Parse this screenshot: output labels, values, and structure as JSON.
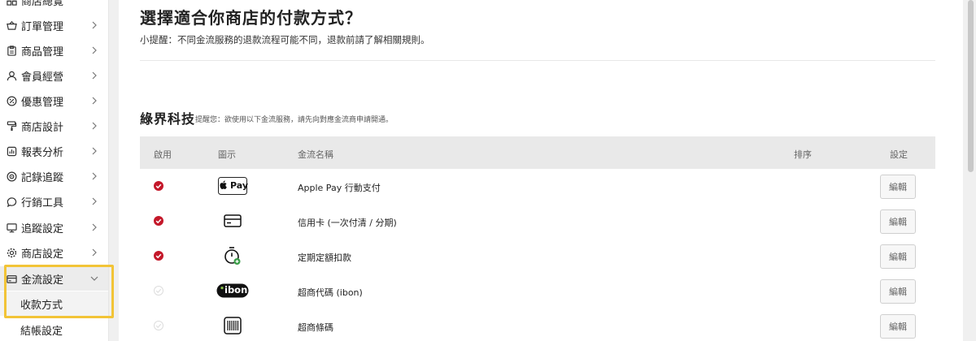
{
  "sidebar": {
    "items": [
      {
        "label": "商店總覽",
        "icon": "grid-icon"
      },
      {
        "label": "訂單管理",
        "icon": "basket-icon"
      },
      {
        "label": "商品管理",
        "icon": "clipboard-icon"
      },
      {
        "label": "會員經營",
        "icon": "user-icon"
      },
      {
        "label": "優惠管理",
        "icon": "discount-icon"
      },
      {
        "label": "商店設計",
        "icon": "paint-roller-icon"
      },
      {
        "label": "報表分析",
        "icon": "chart-icon"
      },
      {
        "label": "記錄追蹤",
        "icon": "target-icon"
      },
      {
        "label": "行銷工具",
        "icon": "megaphone-icon"
      },
      {
        "label": "追蹤設定",
        "icon": "monitor-icon"
      },
      {
        "label": "商店設定",
        "icon": "gear-icon"
      },
      {
        "label": "金流設定",
        "icon": "card-icon"
      }
    ],
    "sub_items": [
      {
        "label": "收款方式"
      },
      {
        "label": "結帳設定"
      }
    ]
  },
  "page": {
    "title": "選擇適合你商店的付款方式？",
    "tip": "小提醒：不同金流服務的退款流程可能不同，退款前請了解相關規則。"
  },
  "section": {
    "title": "綠界科技",
    "note": "提醒您：欲使用以下金流服務，請先向對應金流商申請開通。"
  },
  "table": {
    "headers": [
      "啟用",
      "圖示",
      "金流名稱",
      "排序",
      "設定"
    ],
    "rows": [
      {
        "enabled": true,
        "icon": "apple-pay-icon",
        "logo_text": "Pay",
        "name": "Apple Pay 行動支付",
        "action": "編輯"
      },
      {
        "enabled": true,
        "icon": "credit-card-icon",
        "name": "信用卡 (一次付清 / 分期)",
        "action": "編輯"
      },
      {
        "enabled": true,
        "icon": "timer-icon",
        "name": "定期定額扣款",
        "action": "編輯"
      },
      {
        "enabled": false,
        "icon": "ibon-icon",
        "logo_text": "ibon",
        "name": "超商代碼 (ibon)",
        "action": "編輯"
      },
      {
        "enabled": false,
        "icon": "barcode-icon",
        "name": "超商條碼",
        "action": "編輯"
      }
    ]
  },
  "colors": {
    "enabled": "#c4182a",
    "highlight": "#f2c437"
  }
}
